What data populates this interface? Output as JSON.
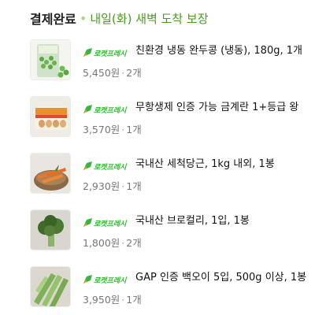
{
  "order": {
    "status": "결제완료",
    "delivery": "내일(화) 새벽 도착 보장",
    "colors": {
      "status": "#222222",
      "delivery": "#4a9a22",
      "badge": "#35b83c"
    }
  },
  "items": [
    {
      "badge": "로켓프레시",
      "name": "친환경 냉동 완두콩 (냉동), 180g, 1개",
      "price": "5,450원",
      "qty": "2개",
      "image_icon": "frozen-peas-bag"
    },
    {
      "badge": "로켓프레시",
      "name": "무항생제 인증 가능 금계란 1+등급 왕",
      "price": "3,570원",
      "qty": "1개",
      "image_icon": "egg-carton"
    },
    {
      "badge": "로켓프레시",
      "name": "국내산 세척당근, 1kg 내외, 1봉",
      "price": "2,930원",
      "qty": "1개",
      "image_icon": "carrots-basket"
    },
    {
      "badge": "로켓프레시",
      "name": "국내산 브로컬리, 1입, 1봉",
      "price": "1,800원",
      "qty": "2개",
      "image_icon": "broccoli"
    },
    {
      "badge": "로켓프레시",
      "name": "GAP 인증 백오이 5입, 500g 이상, 1봉",
      "price": "3,950원",
      "qty": "1개",
      "image_icon": "cucumbers"
    }
  ]
}
